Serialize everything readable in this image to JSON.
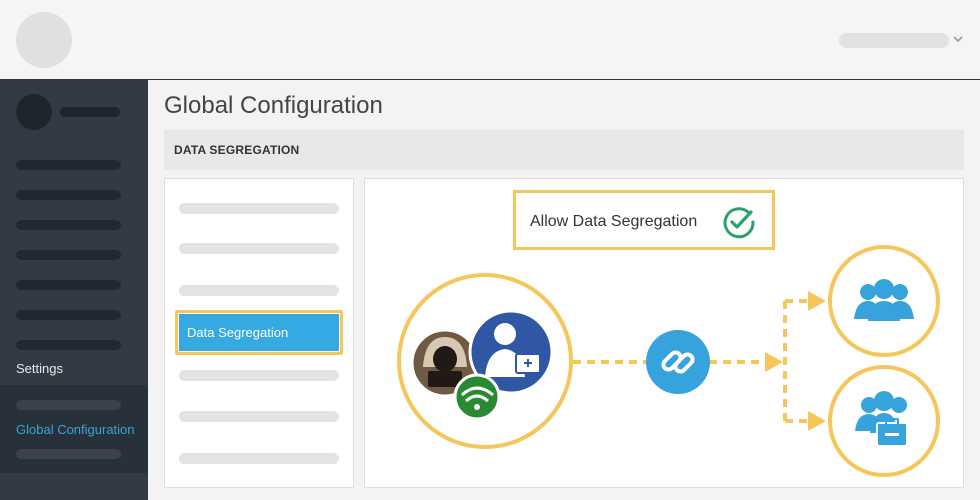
{
  "header": {
    "logo": "avatar-placeholder",
    "user_menu_icon": "chevron-down-icon"
  },
  "sidebar": {
    "settings_label": "Settings",
    "active_item_label": "Global Configuration"
  },
  "main": {
    "title": "Global Configuration",
    "section_label": "DATA SEGREGATION",
    "menu": {
      "active_label": "Data Segregation"
    },
    "feature": {
      "label": "Allow Data Segregation",
      "status_icon": "check-circle-icon"
    },
    "diagram": {
      "source_icons": [
        "hacker-icon",
        "doctor-icon",
        "wifi-icon"
      ],
      "link_icon": "link-icon",
      "target_icons": [
        "user-group-icon",
        "user-group-briefcase-icon"
      ]
    }
  },
  "colors": {
    "accent_blue": "#35a9e1",
    "highlight_yellow": "#f5c65a",
    "success_green": "#2ea06a",
    "sidebar_bg": "#333a44"
  }
}
